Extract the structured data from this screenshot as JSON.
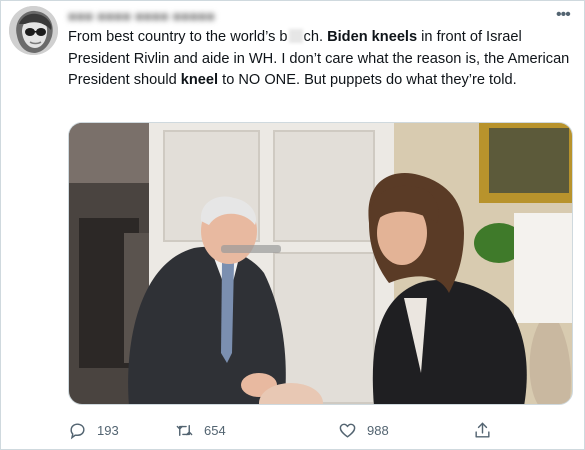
{
  "tweet": {
    "author_obscured": "■■■ ■■■■ ■■■■ ■■■■■",
    "text": {
      "p1": "From best country to the world’s b",
      "p2": "ch. ",
      "b1": "Biden kneels",
      "p3": " in front of Israel President Rivlin and aide in WH. I don’t care what the reason is, the American President should ",
      "b2": "kneel",
      "p4": " to NO ONE. But puppets do what they’re told."
    },
    "counts": {
      "replies": "193",
      "retweets": "654",
      "likes": "988"
    }
  },
  "icons": {
    "more": "more-icon",
    "reply": "reply-icon",
    "retweet": "retweet-icon",
    "like": "heart-icon",
    "share": "share-icon"
  },
  "colors": {
    "text": "#0f1419",
    "secondary": "#536471",
    "border": "#cfd9de"
  }
}
